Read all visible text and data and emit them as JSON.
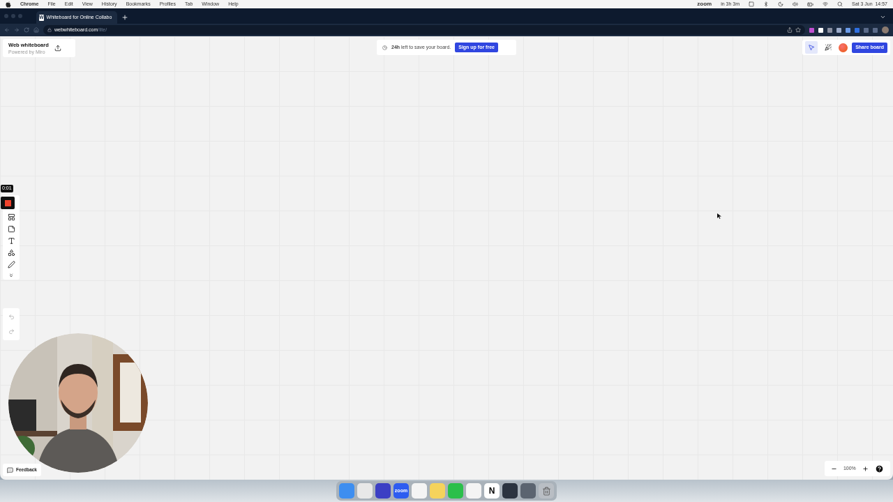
{
  "menu_bar": {
    "app": "Chrome",
    "menus": [
      "File",
      "Edit",
      "View",
      "History",
      "Bookmarks",
      "Profiles",
      "Tab",
      "Window",
      "Help"
    ],
    "zoom_label": "zoom",
    "meeting": "in 3h 3m",
    "clock": "Sat 3 Jun  14:57"
  },
  "browser": {
    "favicon": "W",
    "tab_title": "Whiteboard for Online Collabo",
    "url_host": "webwhiteboard.com",
    "url_path": "/lite/"
  },
  "board": {
    "title": "Web whiteboard",
    "subtitle": "Powered by Miro",
    "banner": {
      "text": "**24h** left to save your board.",
      "button": "Sign up for free"
    },
    "top_tools": [
      {
        "kind": "cursor",
        "selected": true
      },
      {
        "kind": "reactions",
        "selected": false
      }
    ],
    "share_button": "Share board",
    "recording_time": "0:01",
    "tools": [
      {
        "kind": "stop"
      },
      {
        "kind": "frame"
      },
      {
        "kind": "sticky"
      },
      {
        "kind": "text"
      },
      {
        "kind": "shapes"
      },
      {
        "kind": "pen"
      },
      {
        "kind": "more"
      }
    ],
    "history": [
      {
        "kind": "undo",
        "disabled": true
      },
      {
        "kind": "redo",
        "disabled": true
      }
    ],
    "feedback": "Feedback",
    "zoom_level": "100%"
  },
  "dock": [
    {
      "kind": "finder",
      "color": "#3d8ef0"
    },
    {
      "kind": "chrome",
      "color": "#e8e8e8"
    },
    {
      "kind": "sphere",
      "color": "#3b3fc4"
    },
    {
      "kind": "zoom",
      "color": "#2d5cf0",
      "label": "zoom"
    },
    {
      "kind": "slack",
      "color": "#f4f4f4"
    },
    {
      "kind": "notes",
      "color": "#f5d35c"
    },
    {
      "kind": "whatsapp",
      "color": "#2bbf4b"
    },
    {
      "kind": "vscode",
      "color": "#f4f4f4"
    },
    {
      "kind": "notion",
      "color": "#ffffff",
      "label": "N"
    },
    {
      "kind": "window",
      "color": "#2c3440"
    },
    {
      "kind": "window",
      "color": "#5b6470"
    },
    {
      "kind": "trash",
      "color": "#b9bec4"
    }
  ]
}
